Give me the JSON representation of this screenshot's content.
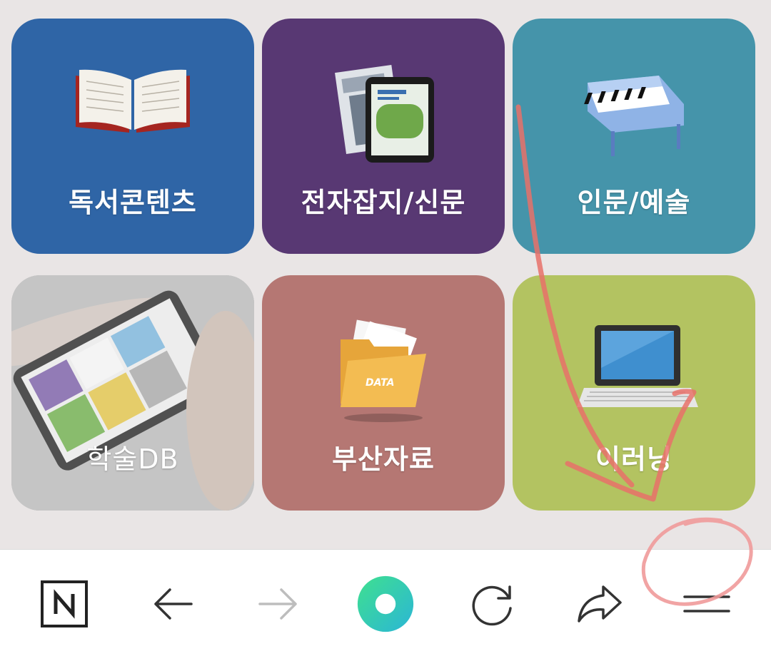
{
  "tiles": [
    {
      "label": "독서콘텐츠",
      "icon": "book-icon",
      "color": "#2f65a6"
    },
    {
      "label": "전자잡지/신문",
      "icon": "magazine-tablet-icon",
      "color": "#583873"
    },
    {
      "label": "인문/예술",
      "icon": "piano-icon",
      "color": "#4594aa"
    },
    {
      "label": "학술DB",
      "icon": "smartphone-hand-icon",
      "color": "#a9a9a9"
    },
    {
      "label": "부산자료",
      "icon": "data-folder-icon",
      "color": "#b57773"
    },
    {
      "label": "이러닝",
      "icon": "laptop-icon",
      "color": "#b3c361"
    }
  ],
  "navbar": {
    "items": [
      {
        "icon": "naver-n-icon"
      },
      {
        "icon": "back-arrow-icon"
      },
      {
        "icon": "forward-arrow-icon",
        "state": "disabled"
      },
      {
        "icon": "green-circle-home-icon"
      },
      {
        "icon": "refresh-icon"
      },
      {
        "icon": "share-icon"
      },
      {
        "icon": "menu-icon"
      }
    ]
  },
  "annotations": {
    "color": "#e8716a"
  }
}
